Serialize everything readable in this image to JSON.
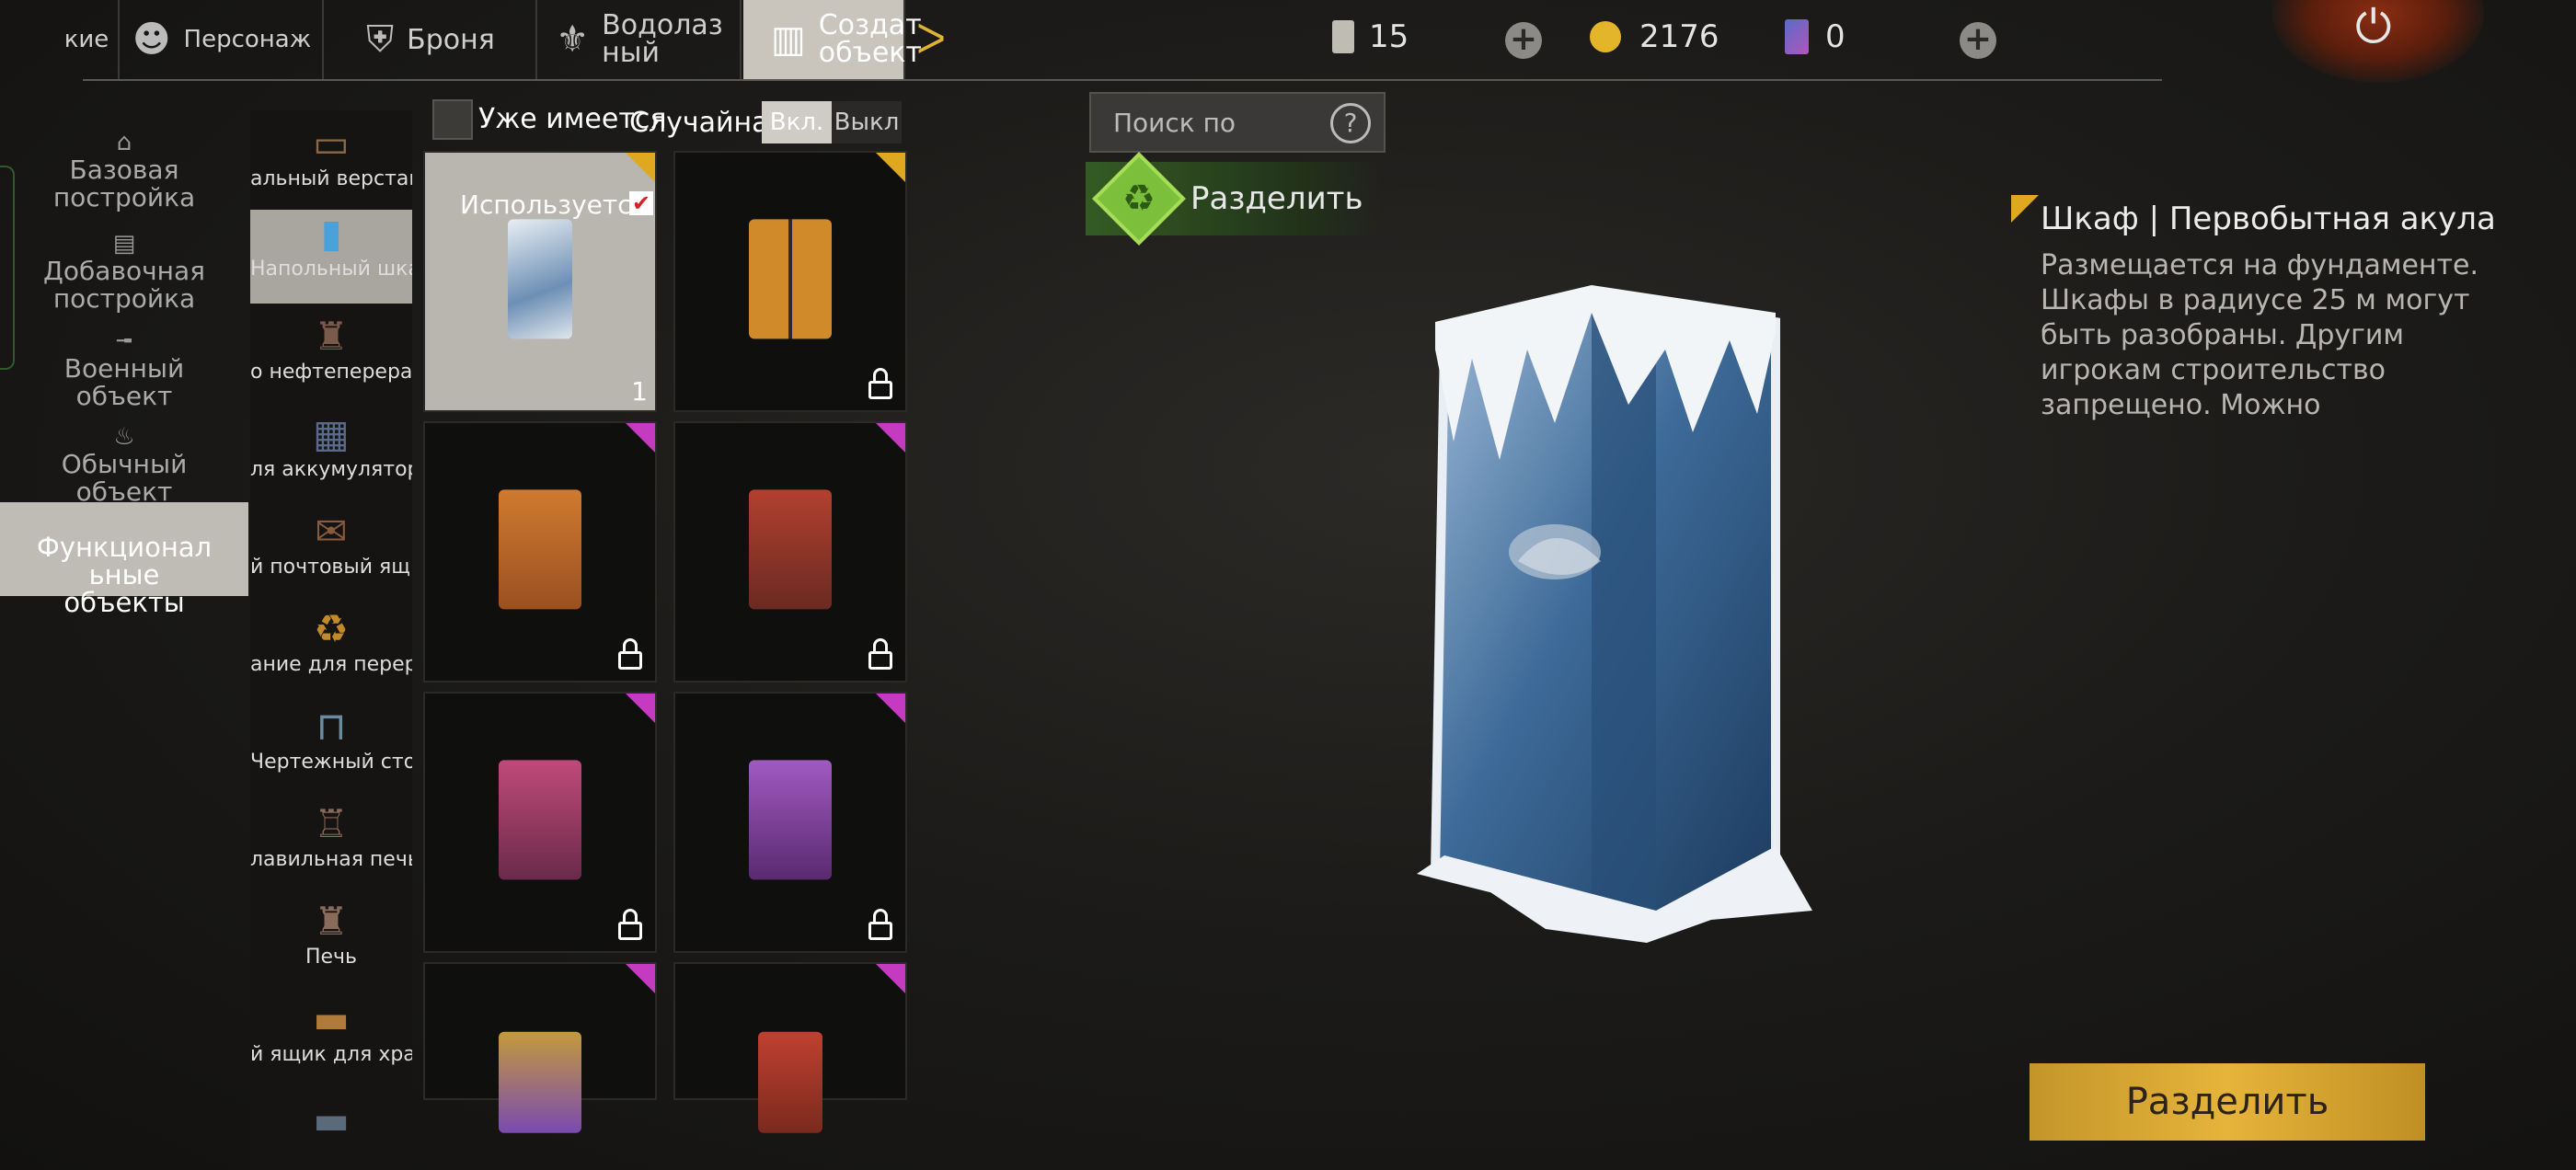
{
  "tabs": [
    {
      "label": "кие",
      "icon": "character-partial-icon"
    },
    {
      "label": "Персонаж",
      "icon": "character-icon"
    },
    {
      "label": "Броня",
      "icon": "armor-icon"
    },
    {
      "label": "Водолаз ный",
      "line1": "Водолаз",
      "line2": "ный",
      "icon": "diver-icon"
    },
    {
      "label": "Создать объект",
      "line1": "Создат",
      "line2": "объект",
      "icon": "build-object-icon"
    }
  ],
  "resources": {
    "tickets": "15",
    "coins": "2176",
    "cards": "0"
  },
  "categories": [
    {
      "line1": "Базовая",
      "line2": "постройка"
    },
    {
      "line1": "Добавочная",
      "line2": "постройка"
    },
    {
      "line1": "Военный",
      "line2": "объект"
    },
    {
      "line1": "Обычный",
      "line2": "объект"
    },
    {
      "line1": "Функционал",
      "line2": "ьные",
      "line3": "объекты"
    }
  ],
  "subitems": [
    {
      "label": "альный верстак"
    },
    {
      "label": "Напольный шкаф"
    },
    {
      "label": "о нефтеперераб"
    },
    {
      "label": "ля аккумуляторо"
    },
    {
      "label": "й почтовый ящи"
    },
    {
      "label": "ание для перера"
    },
    {
      "label": "Чертежный стол"
    },
    {
      "label": "лавильная печь"
    },
    {
      "label": "Печь"
    },
    {
      "label": "й ящик для хра"
    },
    {
      "label": ""
    }
  ],
  "filters": {
    "owned_label": "Уже имеется",
    "random_label": "Случайна",
    "on": "Вкл.",
    "off": "Выкл"
  },
  "search": {
    "placeholder": "Поиск по"
  },
  "split_top_label": "Разделить",
  "grid": {
    "used_label": "Используется",
    "count": "1",
    "items": [
      {
        "rarity": "gold",
        "locked": false,
        "selected": true,
        "color": "#6d8fb5"
      },
      {
        "rarity": "gold",
        "locked": true,
        "color": "#d08a2a"
      },
      {
        "rarity": "purple",
        "locked": true,
        "color": "#c06a2a"
      },
      {
        "rarity": "purple",
        "locked": true,
        "color": "#a0382c"
      },
      {
        "rarity": "purple",
        "locked": true,
        "color": "#b03b6a"
      },
      {
        "rarity": "purple",
        "locked": true,
        "color": "#8c4aa8"
      },
      {
        "rarity": "purple",
        "locked": false,
        "color": "#9a6cc4"
      },
      {
        "rarity": "purple",
        "locked": false,
        "color": "#b83a2a"
      }
    ]
  },
  "detail": {
    "title": "Шкаф | Первобытная акула",
    "description": "Размещается на фундаменте. Шкафы в радиусе 25 м могут быть разобраны. Другим игрокам строительство запрещено. Можно"
  },
  "split_button_label": "Разделить",
  "colors": {
    "accent_gold": "#e0a81e",
    "accent_purple": "#c43bc2",
    "button_gold": "#e6b43a",
    "green": "#7bbf3a"
  }
}
